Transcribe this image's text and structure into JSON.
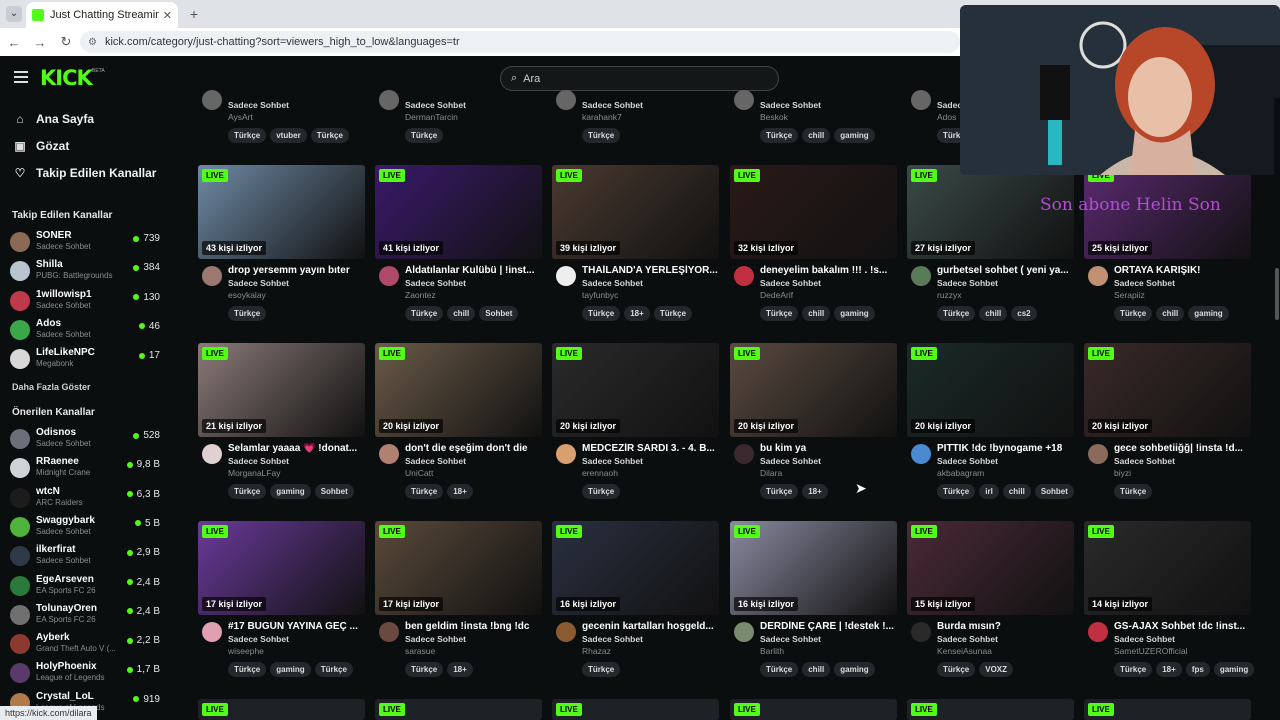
{
  "browser": {
    "tab_title": "Just Chatting Streaming - Live S",
    "url": "kick.com/category/just-chatting?sort=viewers_high_to_low&languages=tr",
    "status_url": "https://kick.com/dilara"
  },
  "header": {
    "logo": "KICK",
    "beta": "BETA",
    "search_placeholder": "Ara"
  },
  "sidebar": {
    "nav": [
      {
        "label": "Ana Sayfa",
        "icon": "home-icon"
      },
      {
        "label": "Gözat",
        "icon": "browse-icon"
      },
      {
        "label": "Takip Edilen Kanallar",
        "icon": "heart-icon"
      }
    ],
    "followed_heading": "Takip Edilen Kanallar",
    "followed": [
      {
        "name": "SONER",
        "category": "Sadece Sohbet",
        "viewers": "739",
        "color": "#8a6a55"
      },
      {
        "name": "Shilla",
        "category": "PUBG: Battlegrounds",
        "viewers": "384",
        "color": "#b9c4d0"
      },
      {
        "name": "1willowisp1",
        "category": "Sadece Sohbet",
        "viewers": "130",
        "color": "#c0394a"
      },
      {
        "name": "Ados",
        "category": "Sadece Sohbet",
        "viewers": "46",
        "color": "#3aa84a"
      },
      {
        "name": "LifeLikeNPC",
        "category": "Megabonk",
        "viewers": "17",
        "color": "#d8d8d8"
      }
    ],
    "show_more": "Daha Fazla Göster",
    "recommended_heading": "Önerilen Kanallar",
    "recommended": [
      {
        "name": "Odisnos",
        "category": "Sadece Sohbet",
        "viewers": "528",
        "color": "#6a6f7a"
      },
      {
        "name": "RRaenee",
        "category": "Midnight Crane",
        "viewers": "9,8 B",
        "color": "#cfd3d8"
      },
      {
        "name": "wtcN",
        "category": "ARC Raiders",
        "viewers": "6,3 B",
        "color": "#1c1c1c"
      },
      {
        "name": "Swaggybark",
        "category": "Sadece Sohbet",
        "viewers": "5 B",
        "color": "#4fb33c"
      },
      {
        "name": "ilkerfirat",
        "category": "Sadece Sohbet",
        "viewers": "2,9 B",
        "color": "#2e3a48"
      },
      {
        "name": "EgeArseven",
        "category": "EA Sports FC 26",
        "viewers": "2,4 B",
        "color": "#2b7a3c"
      },
      {
        "name": "TolunayOren",
        "category": "EA Sports FC 26",
        "viewers": "2,4 B",
        "color": "#707070"
      },
      {
        "name": "Ayberk",
        "category": "Grand Theft Auto V (...",
        "viewers": "2,2 B",
        "color": "#8a3a2e"
      },
      {
        "name": "HolyPhoenix",
        "category": "League of Legends",
        "viewers": "1,7 B",
        "color": "#5a3a6a"
      },
      {
        "name": "Crystal_LoL",
        "category": "League of Legends",
        "viewers": "919",
        "color": "#b07a4a"
      }
    ]
  },
  "top_partial": [
    {
      "category": "Sadece Sohbet",
      "user": "AysArt",
      "tags": [
        "Türkçe",
        "vtuber",
        "Türkçe"
      ]
    },
    {
      "category": "Sadece Sohbet",
      "user": "DermanTarcin",
      "tags": [
        "Türkçe"
      ]
    },
    {
      "category": "Sadece Sohbet",
      "user": "karahank7",
      "tags": [
        "Türkçe"
      ]
    },
    {
      "category": "Sadece Sohbet",
      "user": "Beskok",
      "tags": [
        "Türkçe",
        "chill",
        "gaming"
      ]
    },
    {
      "category": "Sadece",
      "user": "Ados",
      "tags": [
        "Türk"
      ]
    }
  ],
  "row1": [
    {
      "viewers": "43 kişi izliyor",
      "title": "drop yersemm yayın bıter",
      "category": "Sadece Sohbet",
      "user": "esoykalay",
      "tags": [
        "Türkçe"
      ],
      "bg": "#6e8aa5",
      "av": "#9a7a70"
    },
    {
      "viewers": "41 kişi izliyor",
      "title": "Aldatılanlar Kulübü | !inst...",
      "category": "Sadece Sohbet",
      "user": "Zaontez",
      "tags": [
        "Türkçe",
        "chill",
        "Sohbet"
      ],
      "bg": "#3a1a6a",
      "av": "#b04a6a"
    },
    {
      "viewers": "39 kişi izliyor",
      "title": "THAİLAND'A YERLEŞİYOR...",
      "category": "Sadece Sohbet",
      "user": "tayfunbyc",
      "tags": [
        "Türkçe",
        "18+",
        "Türkçe"
      ],
      "bg": "#4a3a30",
      "av": "#eeeeee"
    },
    {
      "viewers": "32 kişi izliyor",
      "title": "deneyelim bakalım !!! . !s...",
      "category": "Sadece Sohbet",
      "user": "DedeArif",
      "tags": [
        "Türkçe",
        "chill",
        "gaming"
      ],
      "bg": "#2a1a18",
      "av": "#c03040"
    },
    {
      "viewers": "27 kişi izliyor",
      "title": "gurbetsel sohbet ( yeni ya...",
      "category": "Sadece Sohbet",
      "user": "ruzzyx",
      "tags": [
        "Türkçe",
        "chill",
        "cs2"
      ],
      "bg": "#3a4a48",
      "av": "#5a7a5a"
    },
    {
      "viewers": "25 kişi izliyor",
      "title": "ORTAYA KARIŞIK!",
      "category": "Sadece Sohbet",
      "user": "Serapiiz",
      "tags": [
        "Türkçe",
        "chill",
        "gaming"
      ],
      "bg": "#5a2a70",
      "av": "#c09070"
    }
  ],
  "row2": [
    {
      "viewers": "21 kişi izliyor",
      "title": "Selamlar yaaaa 💗 !donat...",
      "category": "Sadece Sohbet",
      "user": "MorganaLFay",
      "tags": [
        "Türkçe",
        "gaming",
        "Sohbet"
      ],
      "bg": "#8a7a78",
      "av": "#e0d0d0"
    },
    {
      "viewers": "20 kişi izliyor",
      "title": "don't die eşeğim don't die",
      "category": "Sadece Sohbet",
      "user": "UniCatt",
      "tags": [
        "Türkçe",
        "18+"
      ],
      "bg": "#6a5a48",
      "av": "#b08070"
    },
    {
      "viewers": "20 kişi izliyor",
      "title": "MEDCEZİR SARDI 3. - 4. B...",
      "category": "Sadece Sohbet",
      "user": "erennaoh",
      "tags": [
        "Türkçe"
      ],
      "bg": "#2a2a2a",
      "av": "#d8a070"
    },
    {
      "viewers": "20 kişi izliyor",
      "title": "bu kim ya",
      "category": "Sadece Sohbet",
      "user": "Dilara",
      "tags": [
        "Türkçe",
        "18+"
      ],
      "bg": "#5a4a40",
      "av": "#3a2a30"
    },
    {
      "viewers": "20 kişi izliyor",
      "title": "PITTIK !dc !bynogame +18",
      "category": "Sadece Sohbet",
      "user": "akbabagram",
      "tags": [
        "Türkçe",
        "irl",
        "chill",
        "Sohbet"
      ],
      "bg": "#1a2a28",
      "av": "#4a8ad0"
    },
    {
      "viewers": "20 kişi izliyor",
      "title": "gece sohbetiiğğ| !insta !d...",
      "category": "Sadece Sohbet",
      "user": "biyzi",
      "tags": [
        "Türkçe"
      ],
      "bg": "#3a2a28",
      "av": "#8a6a5a"
    }
  ],
  "row3": [
    {
      "viewers": "17 kişi izliyor",
      "title": "#17 BUGÜN YAYINA GEÇ ...",
      "category": "Sadece Sohbet",
      "user": "wiseephe",
      "tags": [
        "Türkçe",
        "gaming",
        "Türkçe"
      ],
      "bg": "#6a3a9a",
      "av": "#e0a0b0"
    },
    {
      "viewers": "17 kişi izliyor",
      "title": "ben geldim !insta !bng !dc",
      "category": "Sadece Sohbet",
      "user": "sarasue",
      "tags": [
        "Türkçe",
        "18+"
      ],
      "bg": "#5a4a3a",
      "av": "#6a4a40"
    },
    {
      "viewers": "16 kişi izliyor",
      "title": "gecenin kartalları hoşgeld...",
      "category": "Sadece Sohbet",
      "user": "Rhazaz",
      "tags": [
        "Türkçe"
      ],
      "bg": "#2a3040",
      "av": "#8a5a30"
    },
    {
      "viewers": "16 kişi izliyor",
      "title": "DERDİNE ÇARE | !destek !...",
      "category": "Sadece Sohbet",
      "user": "Barlith",
      "tags": [
        "Türkçe",
        "chill",
        "gaming"
      ],
      "bg": "#8a8aa0",
      "av": "#7a8a70"
    },
    {
      "viewers": "15 kişi izliyor",
      "title": "Burda mısın?",
      "category": "Sadece Sohbet",
      "user": "KenseiAsunaa",
      "tags": [
        "Türkçe",
        "VOXZ"
      ],
      "bg": "#4a2a38",
      "av": "#2a2a2a"
    },
    {
      "viewers": "14 kişi izliyor",
      "title": "GS-AJAX Sohbet !dc !inst...",
      "category": "Sadece Sohbet",
      "user": "SametUZEROfficial",
      "tags": [
        "Türkçe",
        "18+",
        "fps",
        "gaming"
      ],
      "bg": "#2a2a2a",
      "av": "#c03040"
    }
  ],
  "live_label": "LIVE",
  "stream_overlay_text": "Son abone Helin Son"
}
